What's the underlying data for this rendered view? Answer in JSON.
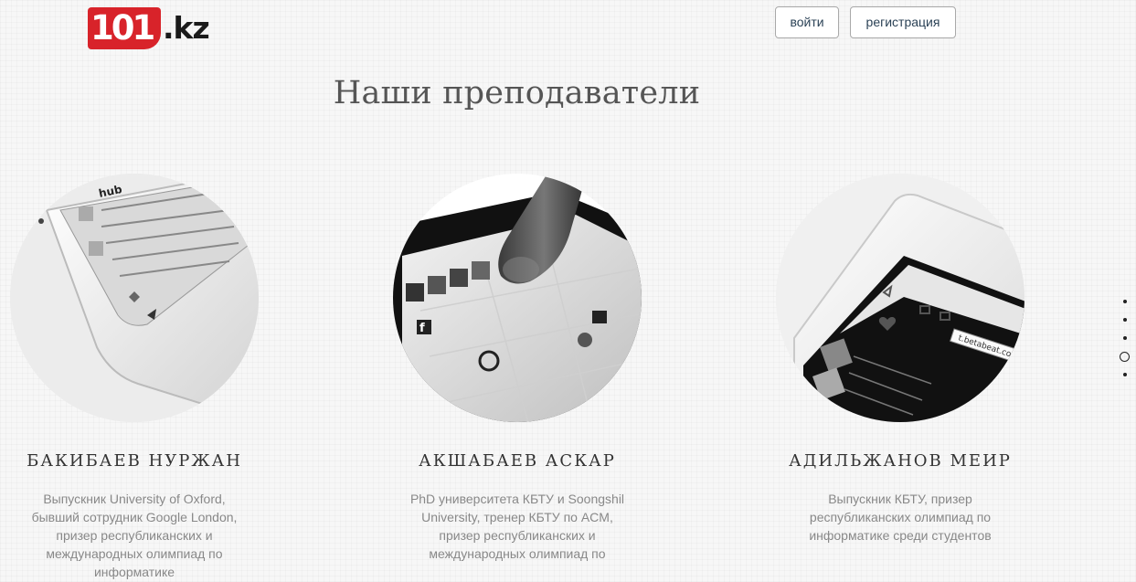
{
  "brand": {
    "logo_digits": "101",
    "logo_tld": ".kz",
    "brand_color": "#d8232a"
  },
  "header": {
    "login_label": "войти",
    "register_label": "регистрация"
  },
  "section": {
    "title": "Наши преподаватели"
  },
  "teachers": [
    {
      "name": "БАКИБАЕВ НУРЖАН",
      "bio": "Выпускник University of Oxford, бывший сотрудник Google London, призер республиканских и международных олимпиад по информатике"
    },
    {
      "name": "АКШАБАЕВ АСКАР",
      "bio": "PhD университета КБТУ и Soongshil University, тренер КБТУ по ACM, призер республиканских и международных олимпиад по"
    },
    {
      "name": "АДИЛЬЖАНОВ МЕИР",
      "bio": "Выпускник КБТУ, призер республиканских олимпиад по информатике среди студентов"
    }
  ],
  "dot_nav": {
    "count": 5,
    "active_index": 3
  }
}
